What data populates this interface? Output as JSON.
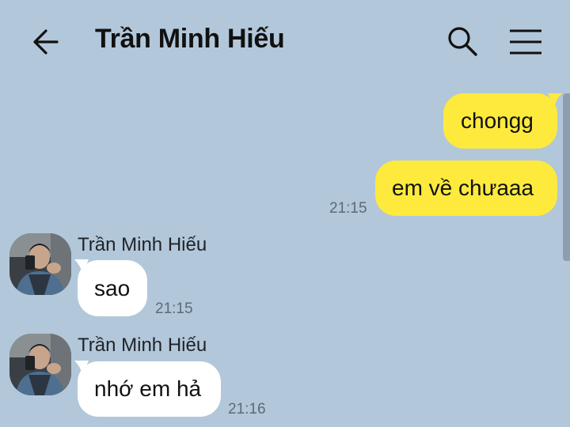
{
  "header": {
    "title": "Trần Minh Hiếu",
    "icons": {
      "back": "arrow-left-icon",
      "search": "search-icon",
      "menu": "menu-icon"
    }
  },
  "colors": {
    "background": "#b2c7da",
    "outgoing_bubble": "#fdea3d",
    "incoming_bubble": "#ffffff"
  },
  "messages": {
    "outgoing": [
      {
        "text": "chongg"
      },
      {
        "text": "em về chưaaa",
        "time": "21:15"
      }
    ],
    "incoming": [
      {
        "sender": "Trần Minh Hiếu",
        "text": "sao",
        "time": "21:15"
      },
      {
        "sender": "Trần Minh Hiếu",
        "text": "nhớ em hả",
        "time": "21:16"
      }
    ]
  }
}
